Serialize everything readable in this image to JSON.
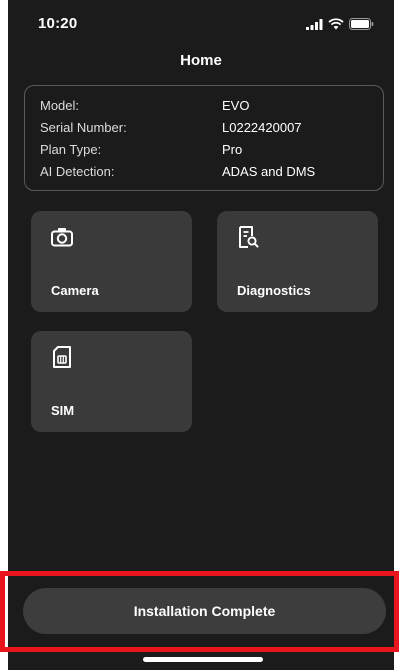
{
  "status_bar": {
    "time": "10:20"
  },
  "header": {
    "title": "Home"
  },
  "device_info": [
    {
      "label": "Model:",
      "value": "EVO"
    },
    {
      "label": "Serial Number:",
      "value": "L0222420007"
    },
    {
      "label": "Plan Type:",
      "value": "Pro"
    },
    {
      "label": "AI Detection:",
      "value": "ADAS and DMS"
    }
  ],
  "tiles": [
    {
      "label": "Camera",
      "icon": "camera-icon"
    },
    {
      "label": "Diagnostics",
      "icon": "document-search-icon"
    },
    {
      "label": "SIM",
      "icon": "sim-card-icon"
    }
  ],
  "footer": {
    "install_label": "Installation Complete"
  },
  "colors": {
    "background": "#1b1b1b",
    "tile": "#3a3a3a",
    "button": "#3d3d3d",
    "highlight": "#e8161c"
  }
}
